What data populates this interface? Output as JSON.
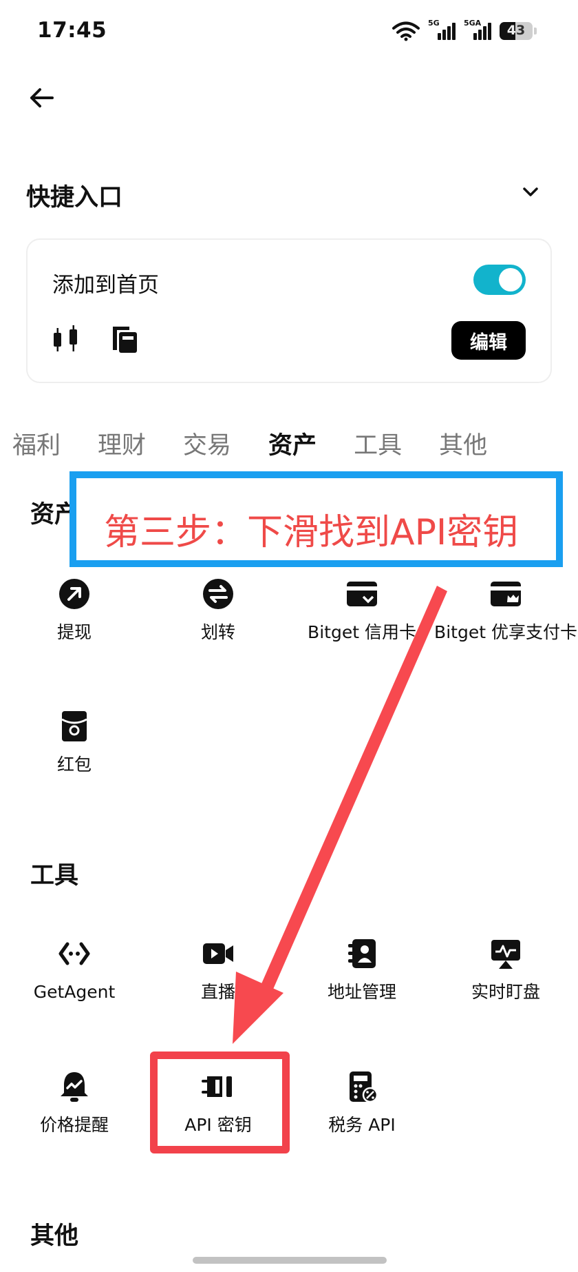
{
  "status_bar": {
    "time": "17:45",
    "signal1_label": "5G",
    "signal2_label": "5GA",
    "battery": "43"
  },
  "header": {
    "back_icon": "arrow-left-icon"
  },
  "shortcut": {
    "title": "快捷入口",
    "add_to_home_label": "添加到首页",
    "toggle_on": true,
    "edit_label": "编辑",
    "accent": "#12b3cc"
  },
  "tabs": [
    "福利",
    "理财",
    "交易",
    "资产",
    "工具",
    "其他"
  ],
  "active_tab": "资产",
  "assets_section": {
    "title": "资产",
    "items": [
      {
        "label": "提现",
        "icon": "withdraw-icon"
      },
      {
        "label": "划转",
        "icon": "transfer-icon"
      },
      {
        "label": "Bitget 信用卡",
        "icon": "credit-card-icon"
      },
      {
        "label": "Bitget 优享支付卡",
        "icon": "premium-card-icon"
      },
      {
        "label": "红包",
        "icon": "red-packet-icon"
      }
    ]
  },
  "tools_section": {
    "title": "工具",
    "items": [
      {
        "label": "GetAgent",
        "icon": "agent-icon"
      },
      {
        "label": "直播",
        "icon": "live-video-icon"
      },
      {
        "label": "地址管理",
        "icon": "address-book-icon"
      },
      {
        "label": "实时盯盘",
        "icon": "monitor-chart-icon"
      },
      {
        "label": "价格提醒",
        "icon": "price-alert-bell-icon"
      },
      {
        "label": "API 密钥",
        "icon": "api-key-plug-icon"
      },
      {
        "label": "税务 API",
        "icon": "tax-calculator-icon"
      }
    ]
  },
  "other_section": {
    "title": "其他"
  },
  "annotation": {
    "instruction": "第三步：下滑找到API密钥",
    "box_color": "#1a9ff0",
    "text_color": "#ef4a48",
    "highlight_color": "#f2424b"
  }
}
